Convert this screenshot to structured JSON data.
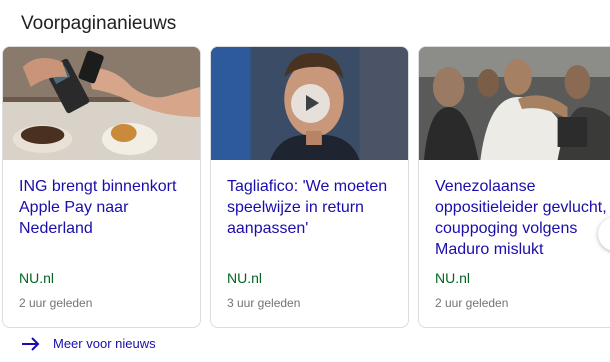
{
  "section": {
    "title": "Voorpaginanieuws"
  },
  "cards": [
    {
      "headline": "ING brengt binnenkort Apple Pay naar Nederland",
      "source": "NU.nl",
      "time": "2 uur geleden",
      "image": "payment-terminal-photo"
    },
    {
      "headline": "Tagliafico: 'We moeten speelwijze in return aanpassen'",
      "source": "NU.nl",
      "time": "3 uur geleden",
      "image": "football-player-video-thumbnail",
      "has_video": true
    },
    {
      "headline": "Venezolaanse oppositieleider gevlucht, couppoging volgens Maduro mislukt",
      "source": "NU.nl",
      "time": "2 uur geleden",
      "image": "crowd-protest-photo"
    }
  ],
  "more": {
    "label": "Meer voor nieuws"
  },
  "colors": {
    "link": "#1a0dab",
    "source": "#006621",
    "meta": "#70757a"
  }
}
